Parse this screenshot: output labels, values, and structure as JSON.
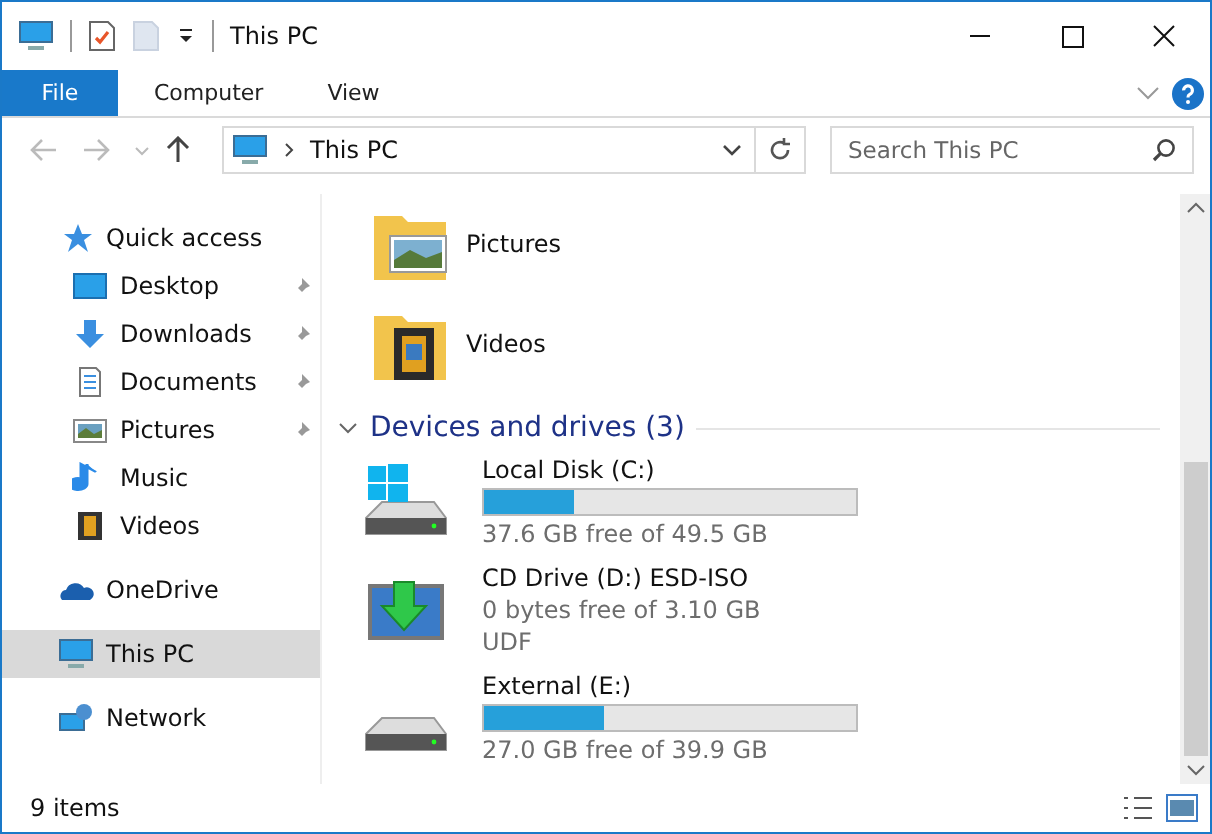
{
  "window": {
    "title": "This PC"
  },
  "ribbon": {
    "file_tab": "File",
    "tabs": [
      {
        "label": "Computer",
        "selected": false
      },
      {
        "label": "View",
        "selected": false
      }
    ]
  },
  "address": {
    "path": "This PC",
    "search_placeholder": "Search This PC"
  },
  "sidebar": {
    "items": [
      {
        "label": "Quick access",
        "kind": "star",
        "selected": false,
        "children": [
          {
            "label": "Desktop",
            "kind": "desktop",
            "pinned": true,
            "selected": false
          },
          {
            "label": "Downloads",
            "kind": "download",
            "pinned": true,
            "selected": false
          },
          {
            "label": "Documents",
            "kind": "document",
            "pinned": true,
            "selected": false
          },
          {
            "label": "Pictures",
            "kind": "picture",
            "pinned": true,
            "selected": false
          },
          {
            "label": "Music",
            "kind": "music",
            "pinned": false,
            "selected": false
          },
          {
            "label": "Videos",
            "kind": "video",
            "pinned": false,
            "selected": false
          }
        ]
      },
      {
        "label": "OneDrive",
        "kind": "cloud",
        "selected": false
      },
      {
        "label": "This PC",
        "kind": "pc",
        "selected": true
      },
      {
        "label": "Network",
        "kind": "network",
        "selected": false
      }
    ]
  },
  "folders": [
    {
      "name": "Pictures",
      "kind": "picture"
    },
    {
      "name": "Videos",
      "kind": "video"
    }
  ],
  "section": {
    "title": "Devices and drives (3)",
    "expanded": true
  },
  "drives": [
    {
      "name": "Local Disk (C:)",
      "kind": "system",
      "level": 0.24,
      "free": "37.6 GB free of 49.5 GB"
    },
    {
      "name": "CD Drive (D:) ESD-ISO",
      "kind": "cd",
      "free": "0 bytes free of 3.10 GB",
      "filesystem": "UDF"
    },
    {
      "name": "External (E:)",
      "kind": "disk",
      "level": 0.32,
      "free": "27.0 GB free of 39.9 GB"
    }
  ],
  "status_bar": {
    "count": "9 items"
  }
}
